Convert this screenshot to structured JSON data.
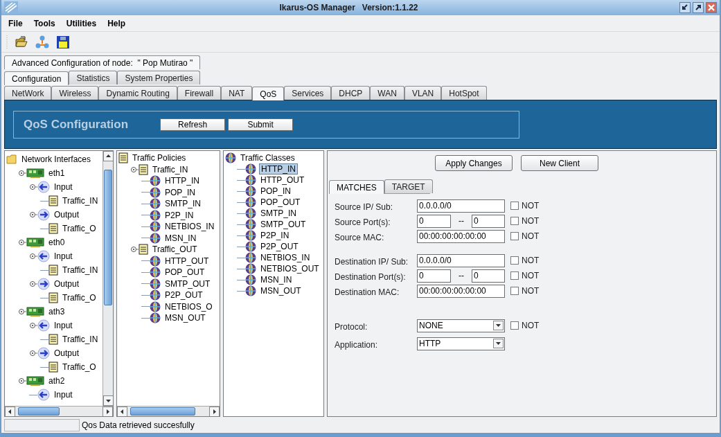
{
  "window": {
    "title": "Ikarus-OS Manager   Version:1.1.22"
  },
  "menu": [
    "File",
    "Tools",
    "Utilities",
    "Help"
  ],
  "node_label": "Advanced Configuration of node:  \" Pop Mutirao \"",
  "main_tabs": [
    {
      "label": "Configuration",
      "selected": true
    },
    {
      "label": "Statistics",
      "selected": false
    },
    {
      "label": "System Properties",
      "selected": false
    }
  ],
  "section_tabs": [
    {
      "label": "NetWork",
      "selected": false
    },
    {
      "label": "Wireless",
      "selected": false
    },
    {
      "label": "Dynamic Routing",
      "selected": false
    },
    {
      "label": "Firewall",
      "selected": false
    },
    {
      "label": "NAT",
      "selected": false
    },
    {
      "label": "QoS",
      "selected": true
    },
    {
      "label": "Services",
      "selected": false
    },
    {
      "label": "DHCP",
      "selected": false
    },
    {
      "label": "WAN",
      "selected": false
    },
    {
      "label": "VLAN",
      "selected": false
    },
    {
      "label": "HotSpot",
      "selected": false
    }
  ],
  "qos_header": {
    "title": "QoS Configuration",
    "buttons": [
      "Refresh",
      "Submit"
    ]
  },
  "interfaces_tree": {
    "label": "Network Interfaces",
    "kind": "folder",
    "children": [
      {
        "label": "eth1",
        "kind": "interface",
        "children": [
          {
            "label": "Input",
            "kind": "input",
            "children": [
              {
                "label": "Traffic_IN",
                "kind": "policy"
              }
            ]
          },
          {
            "label": "Output",
            "kind": "output",
            "children": [
              {
                "label": "Traffic_O",
                "kind": "policy"
              }
            ]
          }
        ]
      },
      {
        "label": "eth0",
        "kind": "interface",
        "children": [
          {
            "label": "Input",
            "kind": "input",
            "children": [
              {
                "label": "Traffic_IN",
                "kind": "policy"
              }
            ]
          },
          {
            "label": "Output",
            "kind": "output",
            "children": [
              {
                "label": "Traffic_O",
                "kind": "policy"
              }
            ]
          }
        ]
      },
      {
        "label": "ath3",
        "kind": "interface",
        "children": [
          {
            "label": "Input",
            "kind": "input",
            "children": [
              {
                "label": "Traffic_IN",
                "kind": "policy"
              }
            ]
          },
          {
            "label": "Output",
            "kind": "output",
            "children": [
              {
                "label": "Traffic_O",
                "kind": "policy"
              }
            ]
          }
        ]
      },
      {
        "label": "ath2",
        "kind": "interface",
        "children": [
          {
            "label": "Input",
            "kind": "input"
          }
        ]
      }
    ]
  },
  "policies_tree": {
    "label": "Traffic Policies",
    "kind": "policy",
    "children": [
      {
        "label": "Traffic_IN",
        "kind": "policy",
        "children": [
          {
            "label": "HTTP_IN",
            "kind": "class"
          },
          {
            "label": "POP_IN",
            "kind": "class"
          },
          {
            "label": "SMTP_IN",
            "kind": "class"
          },
          {
            "label": "P2P_IN",
            "kind": "class"
          },
          {
            "label": "NETBIOS_IN",
            "kind": "class"
          },
          {
            "label": "MSN_IN",
            "kind": "class"
          }
        ]
      },
      {
        "label": "Traffic_OUT",
        "kind": "policy",
        "children": [
          {
            "label": "HTTP_OUT",
            "kind": "class"
          },
          {
            "label": "POP_OUT",
            "kind": "class"
          },
          {
            "label": "SMTP_OUT",
            "kind": "class"
          },
          {
            "label": "P2P_OUT",
            "kind": "class"
          },
          {
            "label": "NETBIOS_O",
            "kind": "class"
          },
          {
            "label": "MSN_OUT",
            "kind": "class"
          }
        ]
      }
    ]
  },
  "classes_tree": {
    "label": "Traffic Classes",
    "kind": "class",
    "children": [
      {
        "label": "HTTP_IN",
        "kind": "class",
        "selected": true
      },
      {
        "label": "HTTP_OUT",
        "kind": "class",
        "selected": false
      },
      {
        "label": "POP_IN",
        "kind": "class",
        "selected": false
      },
      {
        "label": "POP_OUT",
        "kind": "class",
        "selected": false
      },
      {
        "label": "SMTP_IN",
        "kind": "class",
        "selected": false
      },
      {
        "label": "SMTP_OUT",
        "kind": "class",
        "selected": false
      },
      {
        "label": "P2P_IN",
        "kind": "class",
        "selected": false
      },
      {
        "label": "P2P_OUT",
        "kind": "class",
        "selected": false
      },
      {
        "label": "NETBIOS_IN",
        "kind": "class",
        "selected": false
      },
      {
        "label": "NETBIOS_OUT",
        "kind": "class",
        "selected": false
      },
      {
        "label": "MSN_IN",
        "kind": "class",
        "selected": false
      },
      {
        "label": "MSN_OUT",
        "kind": "class",
        "selected": false
      }
    ]
  },
  "editor": {
    "buttons": [
      "Apply Changes",
      "New Client"
    ],
    "tabs": [
      {
        "label": "MATCHES",
        "selected": true
      },
      {
        "label": "TARGET",
        "selected": false
      }
    ],
    "groups": [
      [
        {
          "label": "Source IP/ Sub:",
          "kind": "text",
          "value": "0.0.0.0/0",
          "not_label": "NOT",
          "not_checked": false
        },
        {
          "label": "Source Port(s):",
          "kind": "range",
          "from": "0",
          "separator": "--",
          "to": "0",
          "not_label": "NOT",
          "not_checked": false
        },
        {
          "label": "Source MAC:",
          "kind": "text",
          "value": "00:00:00:00:00:00",
          "not_label": "NOT",
          "not_checked": false
        }
      ],
      [
        {
          "label": "Destination IP/ Sub:",
          "kind": "text",
          "value": "0.0.0.0/0",
          "not_label": "NOT",
          "not_checked": false
        },
        {
          "label": "Destination Port(s):",
          "kind": "range",
          "from": "0",
          "separator": "--",
          "to": "0",
          "not_label": "NOT",
          "not_checked": false
        },
        {
          "label": "Destination MAC:",
          "kind": "text",
          "value": "00:00:00:00:00:00",
          "not_label": "NOT",
          "not_checked": false
        }
      ],
      [
        {
          "label": "Protocol:",
          "kind": "select",
          "value": "NONE",
          "not_label": "NOT",
          "not_checked": false
        },
        {
          "label": "Application:",
          "kind": "select",
          "value": "HTTP"
        }
      ]
    ]
  },
  "status_bar": {
    "message": "Qos Data retrieved succesfully"
  }
}
